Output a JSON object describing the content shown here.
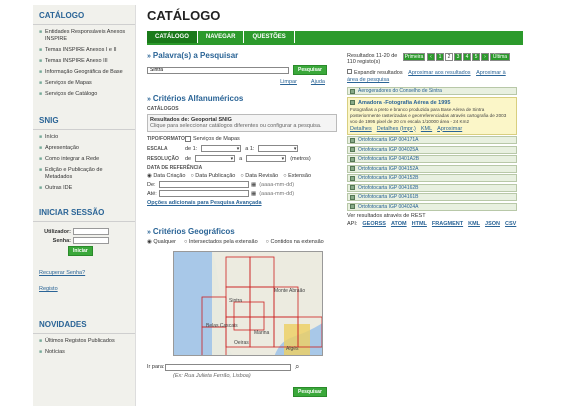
{
  "sidebar": {
    "catalog_title": "CATÁLOGO",
    "catalog_items": [
      "Entidades Responsáveis Anexos INSPIRE",
      "Temas INSPIRE Anexos I e II",
      "Temas INSPIRE Anexo III",
      "Informação Geográfica de Base",
      "Serviços de Mapas",
      "Serviços de Catálogo"
    ],
    "snig_title": "SNIG",
    "snig_items": [
      "Início",
      "Apresentação",
      "Como integrar a Rede",
      "Edição e Publicação de Metadados",
      "Outras IDE"
    ],
    "login_title": "INICIAR SESSÃO",
    "user_label": "Utilizador:",
    "pass_label": "Senha:",
    "login_button": "Iniciar",
    "recover_link": "Recuperar Senha?",
    "register_link": "Registo",
    "news_title": "NOVIDADES",
    "news_items": [
      "Últimos Registos Publicados",
      "Notícias"
    ]
  },
  "header": {
    "title": "CATÁLOGO",
    "tabs": [
      "CATÁLOGO",
      "NAVEGAR",
      "QUESTÕES"
    ]
  },
  "search": {
    "title": "Palavra(s) a Pesquisar",
    "value": "Sintra",
    "button": "Pesquisar",
    "clear": "Limpar",
    "help": "Ajuda"
  },
  "alpha": {
    "title": "Critérios Alfanuméricos",
    "catalogs_label": "CATÁLOGOS",
    "results_from": "Resultados de: Geoportal SNIG",
    "results_hint": "Clique para seleccionar catálogos diferentes ou configurar a pesquisa.",
    "type_label": "TIPO/FORMATO",
    "type_option": "Serviços de Mapas",
    "scale_label": "ESCALA",
    "scale_from": "de 1:",
    "scale_to": "a 1:",
    "resolution_label": "RESOLUÇÃO",
    "res_from": "de",
    "res_to": "a",
    "res_unit": "(metros)",
    "ref_label": "DATA DE REFERÊNCIA",
    "date_options": [
      "Data Criação",
      "Data Publicação",
      "Data Revisão",
      "Extensão"
    ],
    "from_label": "De:",
    "to_label": "Até:",
    "date_hint": "(aaaa-mm-dd)",
    "advanced_link": "Opções adicionais para Pesquisa Avançada"
  },
  "geo": {
    "title": "Critérios Geográficos",
    "options": [
      "Qualquer",
      "Intersectados pela extensão",
      "Contidos na extensão"
    ],
    "place_label": "Ir para:",
    "place_hint": "(Ex: Rua Julieta Ferrão, Lisboa)",
    "search_button": "Pesquisar",
    "map_labels": [
      "Sintra",
      "Belas Cascais",
      "Monte Abraão",
      "Marina",
      "Oeiras",
      "Algés"
    ]
  },
  "results": {
    "summary": "Resultados 11-20 de 110 registo(s)",
    "first": "Primeira",
    "last": "Última",
    "pages": [
      "1",
      "2",
      "3",
      "4",
      "5"
    ],
    "expand_label": "Expandir resultados",
    "add_link": "Aproximar aos resultados",
    "area_link": "Aproximar à área de pesquisa",
    "first_item": "Aerogeradores do Conselho de Sintra",
    "featured": {
      "title": "Amadora -Fotografia Aérea de 1995",
      "desc": "Fotografias a preto e branco produzida para Base Aérea de Sintra posteriormente rasterizadas e georreferenciadas através cartografia de 2003 voo de 1995 pixel de 20 cm escala 1/10000 área - 24 Km2",
      "links": [
        "Detalhes",
        "Detalhes (Impr.)",
        "KML",
        "Aproximar"
      ]
    },
    "items": [
      "Ortofotocarta IGP 004171A",
      "Ortofotocarta IGP 004025A",
      "Ortofotocarta IGP 0401A2B",
      "Ortofotocarta IGP 004152A",
      "Ortofotocarta IGP 004152B",
      "Ortofotocarta IGP 004162B",
      "Ortofotocarta IGP 004161B",
      "Ortofotocarta IGP 004024A"
    ],
    "rest_label": "Ver resultados através de REST",
    "api_label": "API:",
    "api_links": [
      "GEORSS",
      "ATOM",
      "HTML",
      "FRAGMENT",
      "KML",
      "JSON",
      "CSV"
    ]
  },
  "colors": {
    "accent": "#2c9a2c",
    "link": "#2a6496",
    "sidebar_bg": "#f1f1ec"
  }
}
